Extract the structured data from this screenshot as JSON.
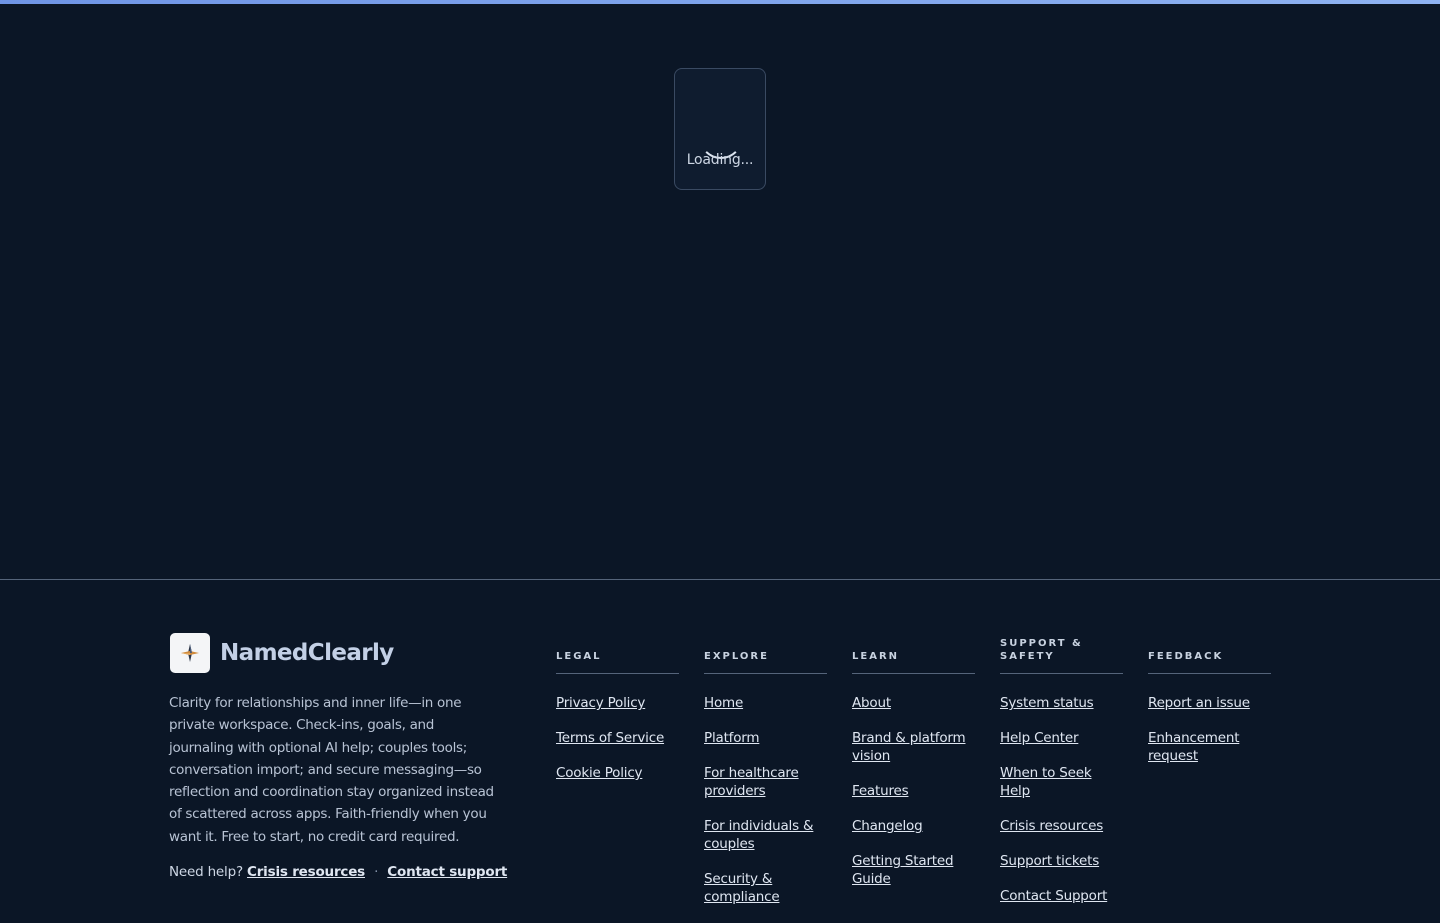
{
  "loading": {
    "text": "Loading..."
  },
  "brand": {
    "name": "NamedClearly",
    "logo_icon": "compass-star-icon"
  },
  "tagline": "Clarity for relationships and inner life—in one private workspace. Check-ins, goals, and journaling with optional AI help; couples tools; conversation import; and secure messaging—so reflection and coordination stay organized instead of scattered across apps. Faith-friendly when you want it. Free to start, no credit card required.",
  "help": {
    "prefix": "Need help?",
    "crisis_link": "Crisis resources",
    "separator": "·",
    "support_link": "Contact support"
  },
  "columns": {
    "legal": {
      "heading": "LEGAL",
      "links": [
        "Privacy Policy",
        "Terms of Service",
        "Cookie Policy"
      ]
    },
    "explore": {
      "heading": "EXPLORE",
      "links": [
        "Home",
        "Platform",
        "For healthcare providers",
        "For individuals & couples",
        "Security & compliance"
      ]
    },
    "learn": {
      "heading": "LEARN",
      "links": [
        "About",
        "Brand & platform vision",
        "Features",
        "Changelog",
        "Getting Started Guide"
      ]
    },
    "support": {
      "heading": "SUPPORT & SAFETY",
      "links": [
        "System status",
        "Help Center",
        "When to Seek Help",
        "Crisis resources",
        "Support tickets",
        "Contact Support"
      ]
    },
    "feedback": {
      "heading": "FEEDBACK",
      "links": [
        "Report an issue",
        "Enhancement request"
      ]
    }
  }
}
